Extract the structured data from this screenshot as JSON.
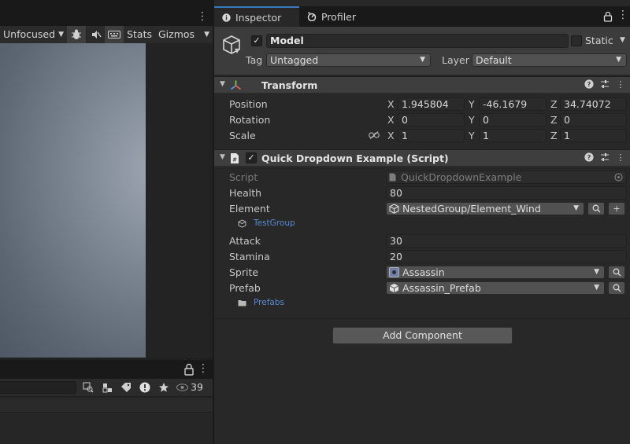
{
  "scene": {
    "toolbar": {
      "focus_label": "Unfocused",
      "stats_label": "Stats",
      "gizmos_label": "Gizmos"
    }
  },
  "project": {
    "visible_count": "39"
  },
  "inspector": {
    "tabs": [
      {
        "label": "Inspector"
      },
      {
        "label": "Profiler"
      }
    ],
    "object": {
      "name": "Model",
      "static_label": "Static",
      "tag_label": "Tag",
      "tag_value": "Untagged",
      "layer_label": "Layer",
      "layer_value": "Default"
    },
    "transform": {
      "title": "Transform",
      "position_label": "Position",
      "rotation_label": "Rotation",
      "scale_label": "Scale",
      "axis_x": "X",
      "axis_y": "Y",
      "axis_z": "Z",
      "position": {
        "x": "1.945804",
        "y": "-46.1679",
        "z": "34.74072"
      },
      "rotation": {
        "x": "0",
        "y": "0",
        "z": "0"
      },
      "scale": {
        "x": "1",
        "y": "1",
        "z": "1"
      }
    },
    "script_component": {
      "title": "Quick Dropdown Example (Script)",
      "script_label": "Script",
      "script_value": "QuickDropdownExample",
      "health_label": "Health",
      "health_value": "80",
      "element_label": "Element",
      "element_value": "NestedGroup/Element_Wind",
      "element_group": "TestGroup",
      "attack_label": "Attack",
      "attack_value": "30",
      "stamina_label": "Stamina",
      "stamina_value": "20",
      "sprite_label": "Sprite",
      "sprite_value": "Assassin",
      "prefab_label": "Prefab",
      "prefab_value": "Assassin_Prefab",
      "prefab_folder": "Prefabs"
    },
    "add_component_label": "Add Component"
  },
  "colors": {
    "accent": "#3a79bb",
    "link": "#5a8bd0"
  }
}
